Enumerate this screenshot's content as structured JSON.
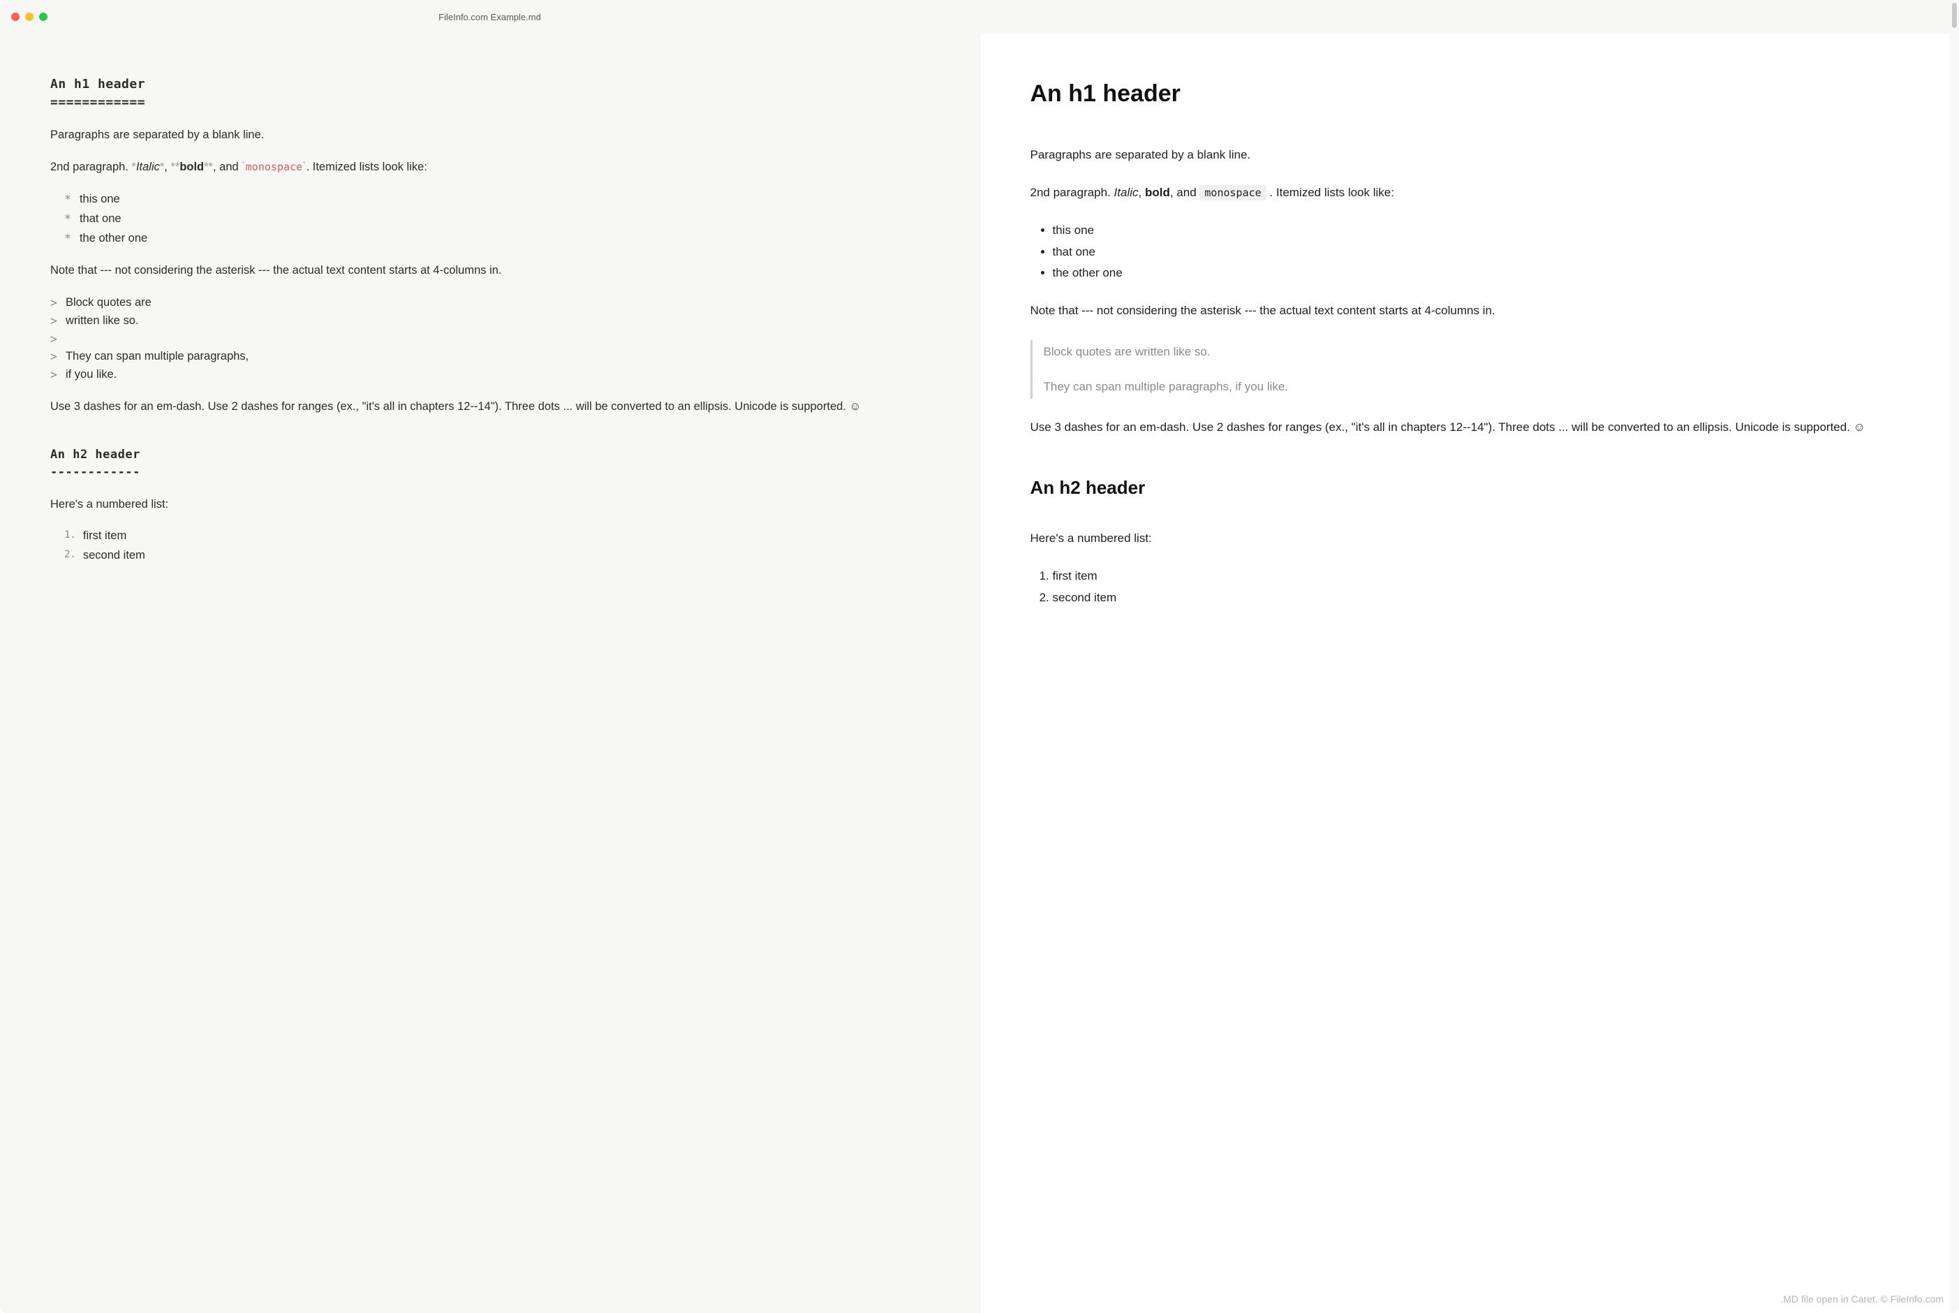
{
  "window": {
    "title": "FileInfo.com Example.md"
  },
  "source": {
    "h1_text": "An h1 header",
    "h1_underline": "============",
    "p1": "Paragraphs are separated by a blank line.",
    "p2_a": "2nd paragraph. ",
    "p2_italic": "Italic",
    "p2_b": ", ",
    "p2_bold": "bold",
    "p2_c": ", and ",
    "p2_code": "monospace",
    "p2_d": ". Itemized lists look like:",
    "bullets": [
      "this one",
      "that one",
      "the other one"
    ],
    "p3": "Note that --- not considering the asterisk --- the actual text content starts at 4-columns in.",
    "quotes": [
      "Block quotes are",
      "written like so.",
      "",
      "They can span multiple paragraphs,",
      "if you like."
    ],
    "p4": "Use 3 dashes for an em-dash. Use 2 dashes for ranges (ex., \"it's all in chapters 12--14\"). Three dots ... will be converted to an ellipsis. Unicode is supported. ☺",
    "h2_text": "An h2 header",
    "h2_underline": "------------",
    "p5": "Here's a numbered list:",
    "nums": [
      "first item",
      "second item"
    ]
  },
  "rendered": {
    "h1": "An h1 header",
    "p1": "Paragraphs are separated by a blank line.",
    "p2_a": "2nd paragraph. ",
    "p2_italic": "Italic",
    "p2_b": ", ",
    "p2_bold": "bold",
    "p2_c": ", and ",
    "p2_code": "monospace",
    "p2_d": ". Itemized lists look like:",
    "bullets": [
      "this one",
      "that one",
      "the other one"
    ],
    "p3": "Note that --- not considering the asterisk --- the actual text content starts at 4-columns in.",
    "bq1": "Block quotes are written like so.",
    "bq2": "They can span multiple paragraphs, if you like.",
    "p4": "Use 3 dashes for an em-dash. Use 2 dashes for ranges (ex., \"it's all in chapters 12--14\"). Three dots ... will be converted to an ellipsis. Unicode is supported. ☺",
    "h2": "An h2 header",
    "p5": "Here's a numbered list:",
    "nums": [
      "first item",
      "second item"
    ]
  },
  "footer": ".MD file open in Caret. © FileInfo.com"
}
